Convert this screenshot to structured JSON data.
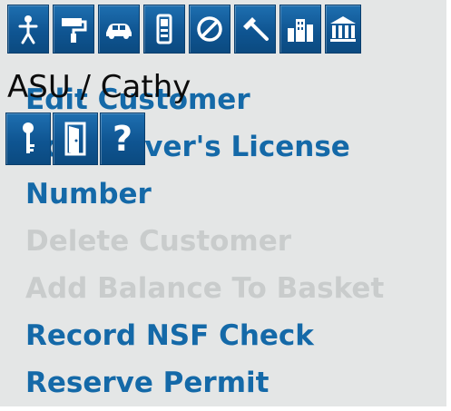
{
  "toolbar": {
    "buttons": [
      {
        "icon": "person-icon"
      },
      {
        "icon": "paint-roller-icon"
      },
      {
        "icon": "car-icon"
      },
      {
        "icon": "mobile-device-icon"
      },
      {
        "icon": "prohibited-icon"
      },
      {
        "icon": "gavel-icon"
      },
      {
        "icon": "buildings-icon"
      },
      {
        "icon": "courthouse-icon"
      }
    ]
  },
  "breadcrumb": "ASU / Cathy",
  "subtoolbar": {
    "buttons": [
      {
        "icon": "key-icon"
      },
      {
        "icon": "door-icon"
      },
      {
        "icon": "help-icon",
        "label": "?"
      }
    ]
  },
  "menu": {
    "items": [
      {
        "label": "Edit Customer",
        "enabled": true
      },
      {
        "label": "Edit Driver's License",
        "enabled": true
      },
      {
        "label": "Number",
        "enabled": true
      },
      {
        "label": "Delete Customer",
        "enabled": false
      },
      {
        "label": "Add Balance To Basket",
        "enabled": false
      },
      {
        "label": "Record NSF Check",
        "enabled": true
      },
      {
        "label": "Reserve Permit",
        "enabled": true
      }
    ]
  },
  "colors": {
    "button_blue": "#0f5592",
    "link_blue": "#1469a8",
    "disabled_gray": "#c9cccc",
    "panel_bg": "#e4e6e6"
  }
}
